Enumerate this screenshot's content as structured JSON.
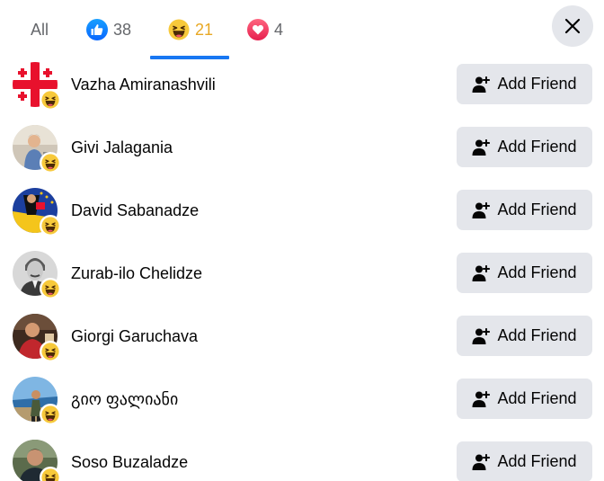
{
  "tabs": [
    {
      "label": "All",
      "count": "",
      "icon": "all"
    },
    {
      "label": "",
      "count": "38",
      "icon": "like-icon"
    },
    {
      "label": "",
      "count": "21",
      "icon": "haha-icon"
    },
    {
      "label": "",
      "count": "4",
      "icon": "love-icon"
    }
  ],
  "active_tab": 2,
  "colors": {
    "accent": "#1877f2",
    "haha_count": "#e8a824",
    "button_bg": "#e4e6eb",
    "secondary_text": "#65676b"
  },
  "close_icon": "close-icon",
  "people": [
    {
      "name": "Vazha Amiranashvili",
      "reaction": "haha-icon",
      "button_label": "Add Friend"
    },
    {
      "name": "Givi Jalagania",
      "reaction": "haha-icon",
      "button_label": "Add Friend"
    },
    {
      "name": "David Sabanadze",
      "reaction": "haha-icon",
      "button_label": "Add Friend"
    },
    {
      "name": "Zurab-ilo Chelidze",
      "reaction": "haha-icon",
      "button_label": "Add Friend"
    },
    {
      "name": "Giorgi Garuchava",
      "reaction": "haha-icon",
      "button_label": "Add Friend"
    },
    {
      "name": "გიო ფალიანი",
      "reaction": "haha-icon",
      "button_label": "Add Friend"
    },
    {
      "name": "Soso Buzaladze",
      "reaction": "haha-icon",
      "button_label": "Add Friend"
    }
  ]
}
